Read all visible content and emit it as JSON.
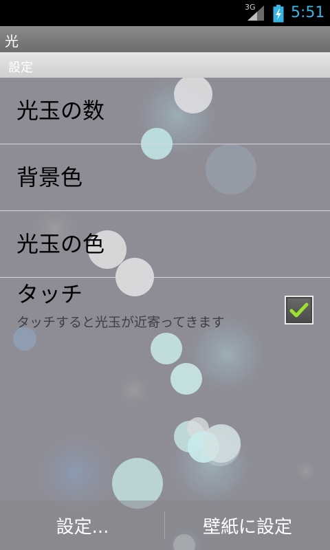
{
  "status_bar": {
    "network": "3G",
    "time": "5:51",
    "battery_icon": "battery-charging-icon",
    "signal_icon": "signal-icon",
    "accent_color": "#33b5e5"
  },
  "app": {
    "title": "光"
  },
  "section": {
    "header": "設定"
  },
  "preferences": [
    {
      "title": "光玉の数"
    },
    {
      "title": "背景色"
    },
    {
      "title": "光玉の色"
    },
    {
      "title": "タッチ",
      "summary": "タッチすると光玉が近寄ってきます",
      "checked": true
    }
  ],
  "bottom_bar": {
    "settings_label": "設定...",
    "set_wallpaper_label": "壁紙に設定"
  },
  "colors": {
    "background": "#8e8d96",
    "checkmark": "#9be22c"
  }
}
